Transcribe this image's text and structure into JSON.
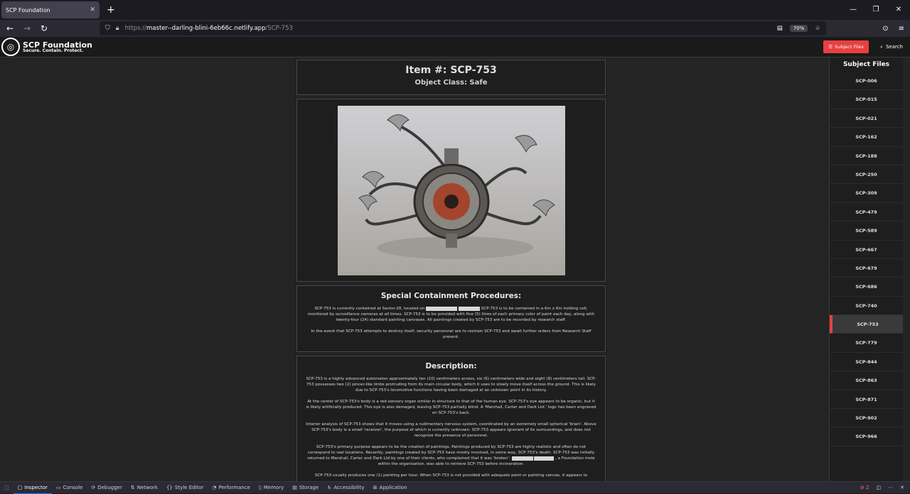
{
  "browser": {
    "tab_title": "SCP Foundation",
    "tab_close": "✕",
    "new_tab": "+",
    "url_prefix": "https://",
    "url_host": "master--darling-blini-6eb66c.netlify.app",
    "url_path": "/SCP-753",
    "zoom": "70%",
    "win_min": "—",
    "win_restore": "❐",
    "win_close": "✕"
  },
  "site": {
    "brand_name": "SCP Foundation",
    "tagline": "Secure. Contain. Protect.",
    "subject_files_button": "Subject Files",
    "search_button": "Search"
  },
  "item": {
    "title": "Item #: SCP-753",
    "object_class": "Object Class: Safe"
  },
  "containment": {
    "heading": "Special Containment Procedures:",
    "p1_a": "SCP-753 is currently contained at Sector-28, located on",
    "p1_b": "SCP-753 is to be contained in a 6m x 6m holding cell, monitored by surveillance cameras at all times. SCP-753 is to be provided with five (5) litres of each primary color of paint each day, along with twenty-four (24) standard painting canvases. All paintings created by SCP-753 are to be recorded by research staff.",
    "p2": "In the event that SCP-753 attempts to destroy itself, security personnel are to restrain SCP-753 and await further orders from Research Staff present."
  },
  "description": {
    "heading": "Description:",
    "p1": "SCP-753 is a highly advanced automaton approximately ten (10) centimeters across, six (6) centimeters wide and eight (8) centimeters tall. SCP-753 possesses two (2) pincer-like limbs protruding from its main circular body, which it uses to slowly move itself across the ground. This is likely due to SCP-753's locomotive functions having been damaged at an unknown point in its history.",
    "p2": "At the center of SCP-753's body is a red sensory organ similar in structure to that of the human eye. SCP-753's eye appears to be organic, but it is likely artificially produced. This eye is also damaged, leaving SCP-753 partially blind. A 'Marshall, Carter and Dark Ltd.' logo has been engraved on SCP-753's back.",
    "p3": "Interior analysis of SCP-753 shows that it moves using a rudimentary nervous system, coordinated by an extremely small spherical 'brain'. Above SCP-753's body is a small 'receiver', the purpose of which is currently unknown. SCP-753 appears ignorant of its surroundings, and does not recognize the presence of personnel.",
    "p4_a": "SCP-753's primary purpose appears to be the creation of paintings. Paintings produced by SCP-753 are highly realistic and often do not correspond to real locations. Recently, paintings created by SCP-753 have mostly involved, in some way, SCP-753's death. SCP-753 was initially returned to Marshall, Carter and Dark Ltd by one of their clients, who complained that it was 'broken'.",
    "p4_b": ", a Foundation mole within the organisation, was able to retrieve SCP-753 before incineration.",
    "p5": "SCP-753 usually produces one (1) painting per hour. When SCP-753 is not provided with adequate paint or painting canvas, it appears to"
  },
  "sidebar": {
    "heading": "Subject Files",
    "items": [
      "SCP-006",
      "SCP-015",
      "SCP-021",
      "SCP-162",
      "SCP-188",
      "SCP-250",
      "SCP-309",
      "SCP-479",
      "SCP-589",
      "SCP-667",
      "SCP-679",
      "SCP-686",
      "SCP-740",
      "SCP-753",
      "SCP-779",
      "SCP-844",
      "SCP-863",
      "SCP-871",
      "SCP-902",
      "SCP-966"
    ],
    "active": "SCP-753"
  },
  "devtools": {
    "tabs": [
      "Inspector",
      "Console",
      "Debugger",
      "Network",
      "Style Editor",
      "Performance",
      "Memory",
      "Storage",
      "Accessibility",
      "Application"
    ],
    "active": "Inspector",
    "error_count": "2"
  },
  "colors": {
    "accent": "#e84040",
    "page_bg": "#242424",
    "box_bg": "#1e1e1e"
  }
}
